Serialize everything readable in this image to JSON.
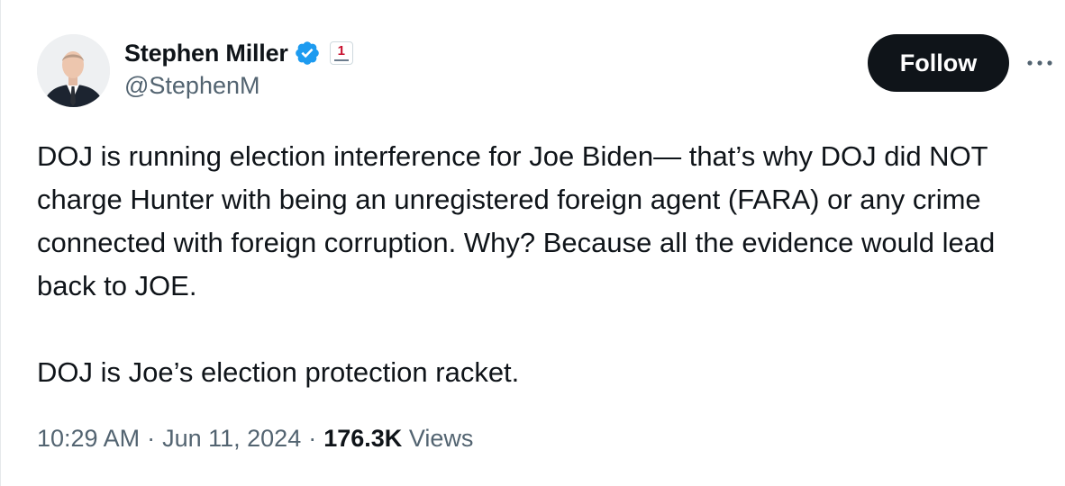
{
  "author": {
    "display_name": "Stephen Miller",
    "handle": "@StephenM",
    "verified_icon": "verified-badge-icon",
    "affiliate_icon": "america-first-affiliate-icon"
  },
  "actions": {
    "follow_label": "Follow",
    "more_icon": "more-horizontal-icon"
  },
  "tweet": {
    "paragraphs": [
      "DOJ is running election interference for Joe Biden— that’s why DOJ did NOT charge Hunter with being an unregistered foreign agent (FARA) or any crime connected with foreign corruption. Why? Because all the evidence would lead back to JOE.",
      "DOJ is Joe’s election protection racket."
    ]
  },
  "meta": {
    "time": "10:29 AM",
    "separator": "·",
    "date": "Jun 11, 2024",
    "views_count": "176.3K",
    "views_label": "Views"
  },
  "colors": {
    "text_primary": "#0f1419",
    "text_secondary": "#536471",
    "verified_blue": "#1d9bf0",
    "follow_bg": "#0f1419"
  }
}
